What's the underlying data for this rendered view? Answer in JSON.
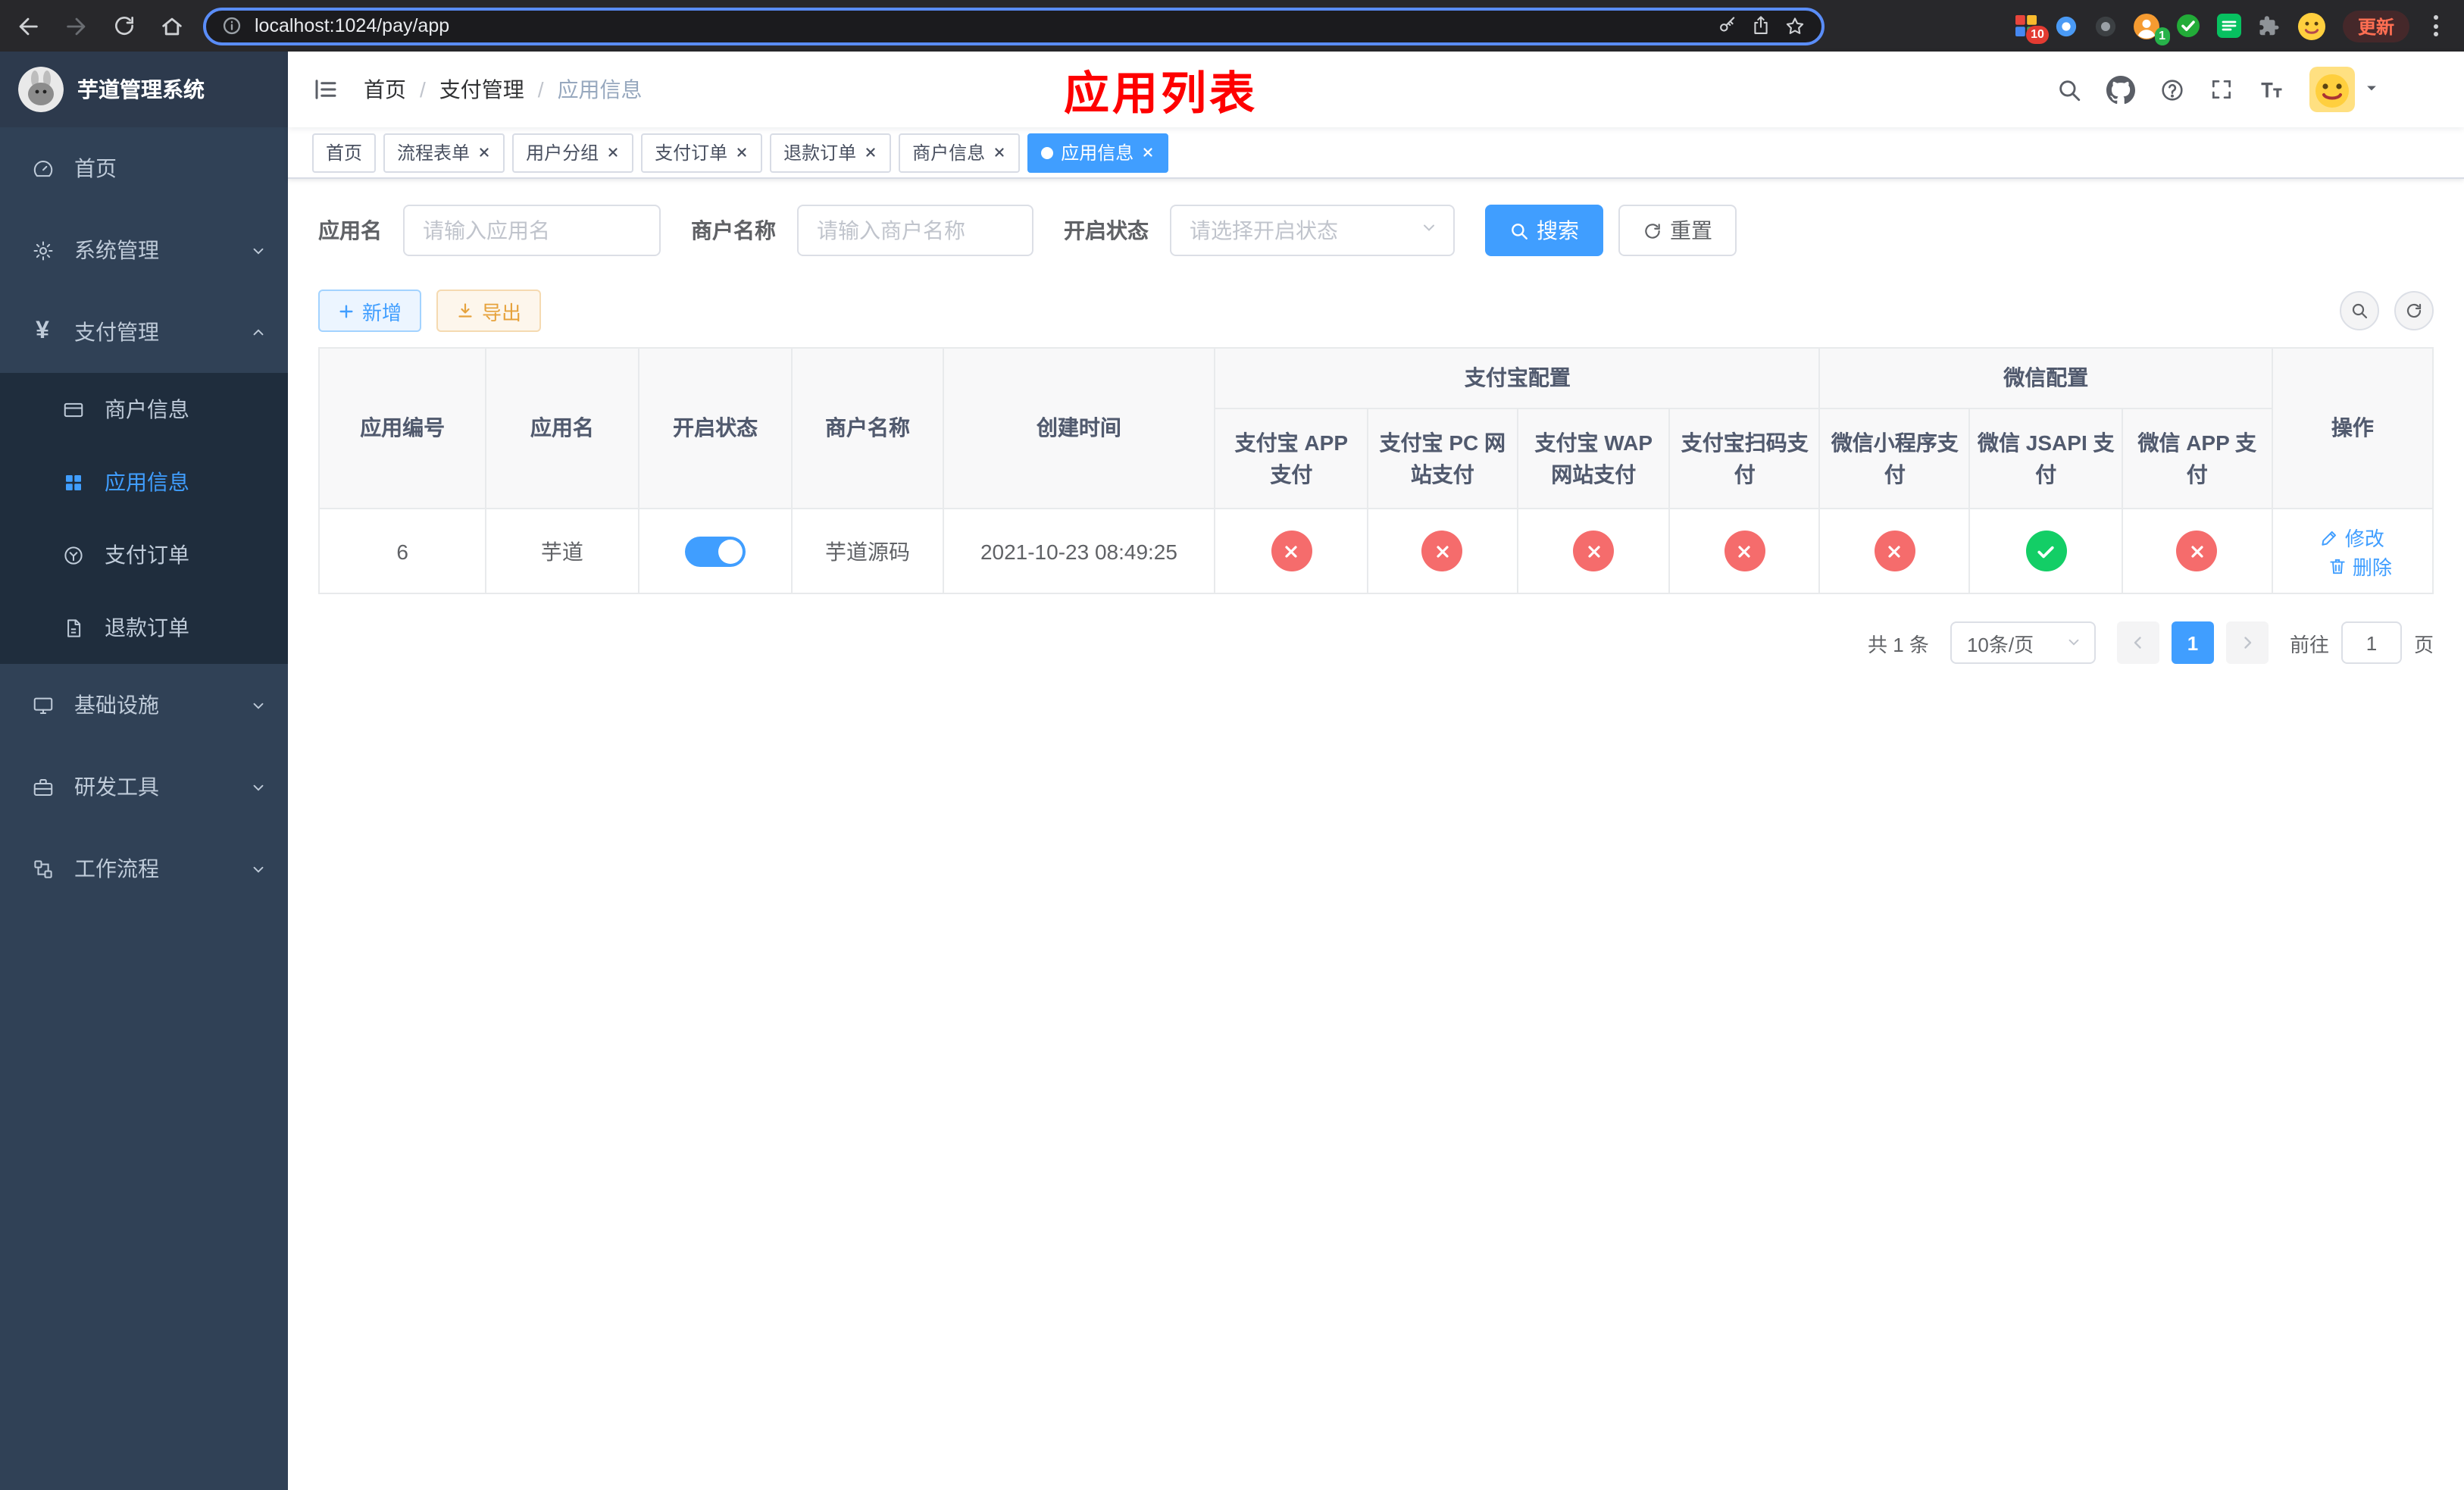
{
  "browser": {
    "url": "localhost:1024/pay/app",
    "update_button": "更新",
    "extensions_badge": "10",
    "avatar_badge": "1"
  },
  "colors": {
    "primary": "#409EFF",
    "success": "#13ce66",
    "danger": "#f56c6c",
    "warning": "#e6a23c",
    "sidebar_bg": "#304156",
    "sidebar_submenu_bg": "#1f2d3d",
    "annotation_red": "#fe0000"
  },
  "icons": {
    "browser": [
      "back-icon",
      "forward-icon",
      "reload-icon",
      "home-icon",
      "info-icon",
      "key-icon",
      "share-icon",
      "bookmark-star-icon",
      "extensions-grid-icon",
      "location-icon",
      "dark-circle-icon",
      "person-icon",
      "check-circle-icon",
      "chat-icon",
      "puzzle-icon",
      "emoji-avatar-icon",
      "kebab-menu-icon"
    ],
    "navbar": [
      "hamburger-icon",
      "search-icon",
      "github-icon",
      "help-icon",
      "fullscreen-icon",
      "font-size-icon",
      "caret-down-icon"
    ],
    "sidebar": [
      "dashboard-icon",
      "gear-icon",
      "yen-icon",
      "bank-card-icon",
      "app-grid-icon",
      "pay-order-icon",
      "refund-doc-icon",
      "monitor-icon",
      "toolbox-icon",
      "workflow-icon"
    ],
    "actions": [
      "plus-icon",
      "download-icon",
      "search-icon",
      "refresh-icon",
      "edit-icon",
      "delete-icon"
    ]
  },
  "sidebar": {
    "title": "芋道管理系统",
    "menu": [
      {
        "label": "首页"
      },
      {
        "label": "系统管理"
      },
      {
        "label": "支付管理"
      },
      {
        "label": "商户信息"
      },
      {
        "label": "应用信息"
      },
      {
        "label": "支付订单"
      },
      {
        "label": "退款订单"
      },
      {
        "label": "基础设施"
      },
      {
        "label": "研发工具"
      },
      {
        "label": "工作流程"
      }
    ]
  },
  "header": {
    "breadcrumb": [
      "首页",
      "支付管理",
      "应用信息"
    ],
    "separator": "/",
    "annotation": "应用列表"
  },
  "tabs": [
    {
      "label": "首页"
    },
    {
      "label": "流程表单"
    },
    {
      "label": "用户分组"
    },
    {
      "label": "支付订单"
    },
    {
      "label": "退款订单"
    },
    {
      "label": "商户信息"
    },
    {
      "label": "应用信息"
    }
  ],
  "filters": {
    "app_name": {
      "label": "应用名",
      "placeholder": "请输入应用名"
    },
    "merchant_name": {
      "label": "商户名称",
      "placeholder": "请输入商户名称"
    },
    "status": {
      "label": "开启状态",
      "placeholder": "请选择开启状态"
    },
    "search": "搜索",
    "reset": "重置"
  },
  "toolbar": {
    "add": "新增",
    "export": "导出"
  },
  "table": {
    "columns": {
      "id": "应用编号",
      "name": "应用名",
      "status": "开启状态",
      "merchant": "商户名称",
      "created": "创建时间",
      "alipay_group": "支付宝配置",
      "wechat_group": "微信配置",
      "alipay_app": "支付宝 APP 支付",
      "alipay_pc": "支付宝 PC 网站支付",
      "alipay_wap": "支付宝 WAP 网站支付",
      "alipay_qr": "支付宝扫码支付",
      "wechat_lite": "微信小程序支付",
      "wechat_jsapi": "微信 JSAPI 支付",
      "wechat_app": "微信 APP 支付",
      "actions": "操作"
    },
    "rows": [
      {
        "id": "6",
        "name": "芋道",
        "status_enabled": true,
        "merchant": "芋道源码",
        "created": "2021-10-23 08:49:25",
        "alipay_app": false,
        "alipay_pc": false,
        "alipay_wap": false,
        "alipay_qr": false,
        "wechat_lite": false,
        "wechat_jsapi": true,
        "wechat_app": false,
        "edit": "修改",
        "delete": "删除"
      }
    ]
  },
  "pagination": {
    "total": "共 1 条",
    "page_size": "10条/页",
    "page": "1",
    "goto": "前往",
    "goto_value": "1",
    "unit": "页"
  }
}
